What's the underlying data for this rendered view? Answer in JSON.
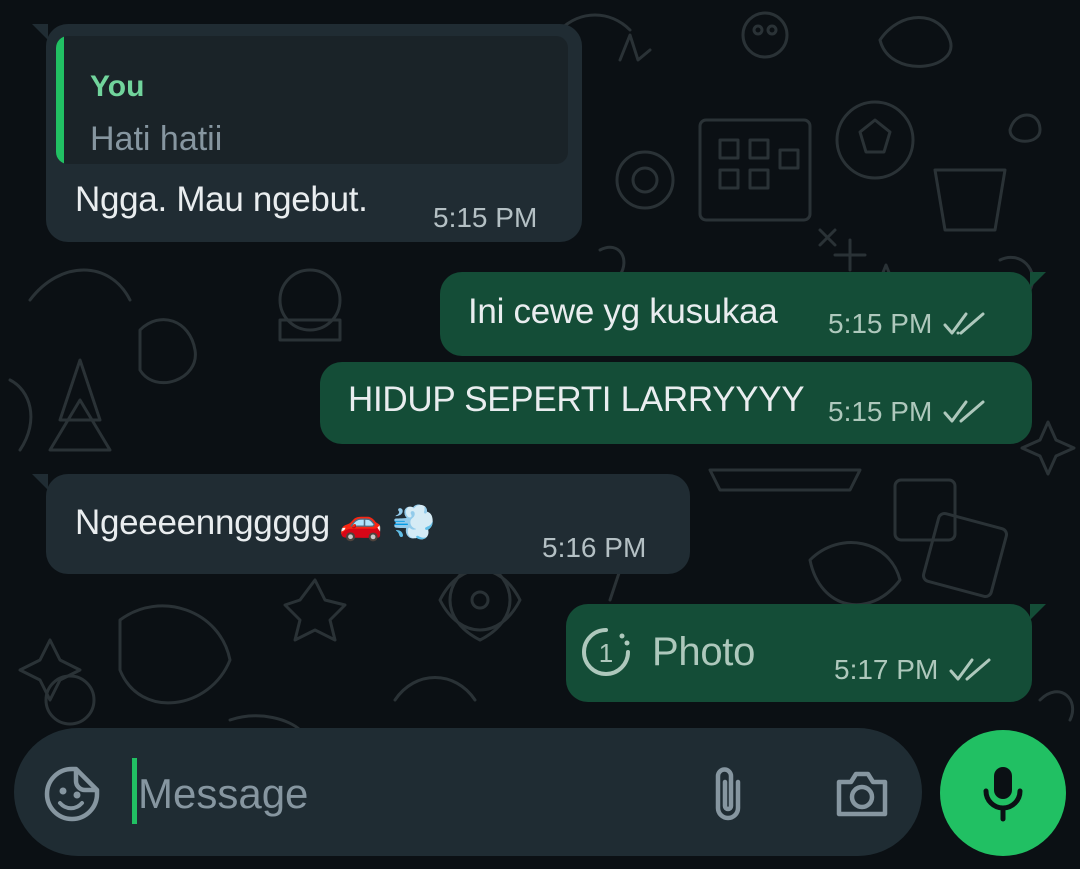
{
  "chat": {
    "messages": [
      {
        "direction": "incoming",
        "quoted": {
          "author": "You",
          "text": "Hati hatii"
        },
        "text": "Ngga. Mau ngebut.",
        "time": "5:15 PM"
      },
      {
        "direction": "outgoing",
        "text": "Ini cewe yg kusukaa",
        "time": "5:15 PM",
        "status": "read"
      },
      {
        "direction": "outgoing",
        "text": "HIDUP SEPERTI LARRYYYY",
        "time": "5:15 PM",
        "status": "read"
      },
      {
        "direction": "incoming",
        "text": "Ngeeeennggggg",
        "emojis": [
          "🚗",
          "💨"
        ],
        "time": "5:16 PM"
      },
      {
        "direction": "outgoing",
        "media_icon": "view-once-icon",
        "view_once_number": "1",
        "text": "Photo",
        "time": "5:17 PM",
        "status": "read"
      }
    ]
  },
  "composer": {
    "placeholder": "Message",
    "icons": {
      "sticker": "sticker-icon",
      "attach": "paperclip-icon",
      "camera": "camera-icon",
      "mic": "microphone-icon"
    }
  },
  "colors": {
    "background": "#0b1014",
    "incoming_bubble": "#202c33",
    "outgoing_bubble": "#144d37",
    "accent_green": "#21c063",
    "composer_bg": "#1f2c33"
  }
}
